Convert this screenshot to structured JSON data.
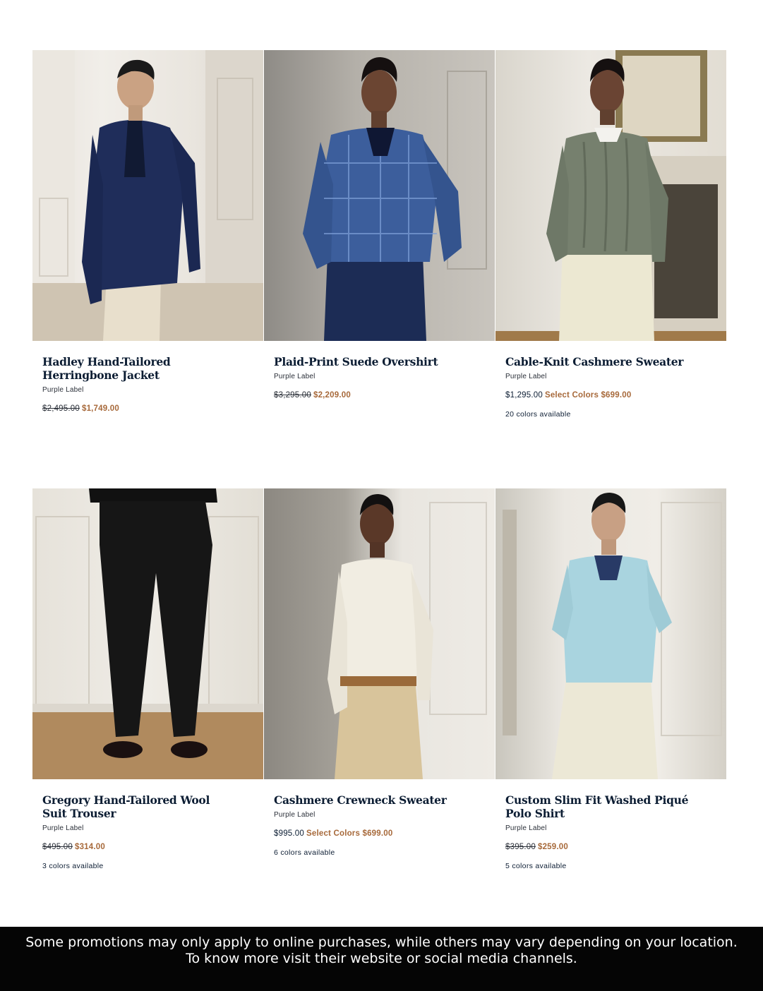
{
  "products": [
    {
      "name": "Hadley Hand-Tailored Herringbone Jacket",
      "brand": "Purple Label",
      "price_old": "$2,495.00",
      "price_sale": "$1,749.00",
      "image": "man-navy-blazer-photo"
    },
    {
      "name": "Plaid-Print Suede Overshirt",
      "brand": "Purple Label",
      "price_old": "$3,295.00",
      "price_sale": "$2,209.00",
      "image": "man-blue-plaid-overshirt-photo"
    },
    {
      "name": "Cable-Knit Cashmere Sweater",
      "brand": "Purple Label",
      "price_regular": "$1,295.00",
      "price_sale": "Select Colors $699.00",
      "colors": "20 colors available",
      "image": "man-grey-cable-knit-sweater-photo"
    },
    {
      "name": "Gregory Hand-Tailored Wool Suit Trouser",
      "brand": "Purple Label",
      "price_old": "$495.00",
      "price_sale": "$314.00",
      "colors": "3 colors available",
      "image": "black-wool-trousers-photo"
    },
    {
      "name": "Cashmere Crewneck Sweater",
      "brand": "Purple Label",
      "price_regular": "$995.00",
      "price_sale": "Select Colors $699.00",
      "colors": "6 colors available",
      "image": "man-cream-crewneck-sweater-photo"
    },
    {
      "name": "Custom Slim Fit Washed Piqué Polo Shirt",
      "brand": "Purple Label",
      "price_old": "$395.00",
      "price_sale": "$259.00",
      "colors": "5 colors available",
      "image": "man-light-blue-polo-photo"
    }
  ],
  "footer": {
    "line1": "Some promotions may only apply to online purchases, while others may vary depending on your location.",
    "line2": "To know more visit their website or social media channels."
  },
  "colors": {
    "text": "#0c1d33",
    "sale": "#a7693a",
    "footer_bg": "#050505"
  }
}
